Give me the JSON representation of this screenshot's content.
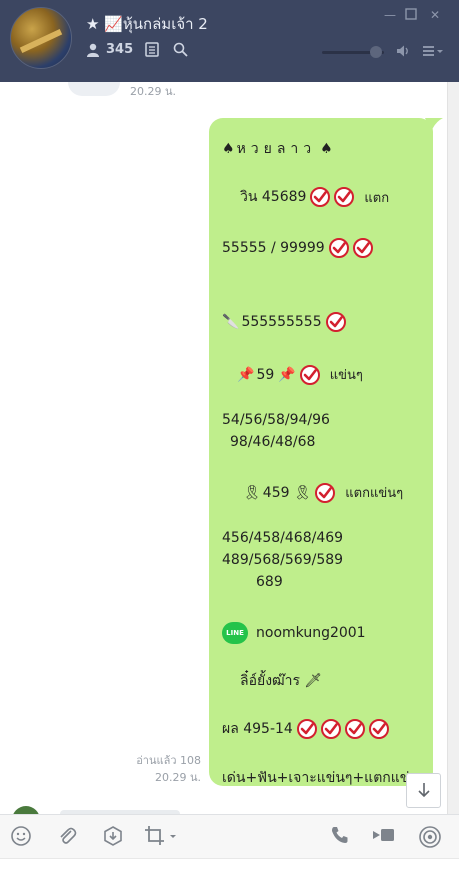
{
  "header": {
    "title": "★ 📈หุ้นกล่มเจ้า 2",
    "member_count": "345"
  },
  "chat": {
    "prev_time": "20.29 น.",
    "message": {
      "lines": [
        {
          "text": "หวยลาว",
          "prefix": "♠",
          "suffix": "♠",
          "checks": 0
        },
        {
          "text": "วิน 45689",
          "checks": 2,
          "after": "แตก"
        },
        {
          "text": "55555 / 99999",
          "checks": 2
        },
        {
          "text": "555555555",
          "prefix": "🔪",
          "checks": 1
        },
        {
          "text": "59",
          "prefix": "📌",
          "suffix": "📌",
          "checks": 1,
          "after": "แข่นๆ"
        },
        {
          "text": "54/56/58/94/96"
        },
        {
          "text": "98/46/48/68"
        },
        {
          "text": "459",
          "prefix": "🎗",
          "suffix": "🎗",
          "checks": 1,
          "after": "แตกแข่นๆ"
        },
        {
          "text": "456/458/468/469"
        },
        {
          "text": "489/568/569/589"
        },
        {
          "text": "689"
        },
        {
          "text": "noomkung2001",
          "badge": "LINE"
        },
        {
          "text": "ลิ๋อ์ยั้งฒ๊าร",
          "suffix": "🗡"
        },
        {
          "text": "ผล 495-14",
          "checks": 4
        },
        {
          "text": "เด่น+ฟัน+เจาะแข่นๆ+แตกแข่นๆ"
        }
      ]
    },
    "read_status": "อ่านแล้ว 108",
    "read_time": "20.29 น."
  },
  "colors": {
    "header_bg": "#3c4661",
    "bubble": "#bfee8c",
    "check_red": "#d3202f",
    "line_green": "#25c34a"
  }
}
